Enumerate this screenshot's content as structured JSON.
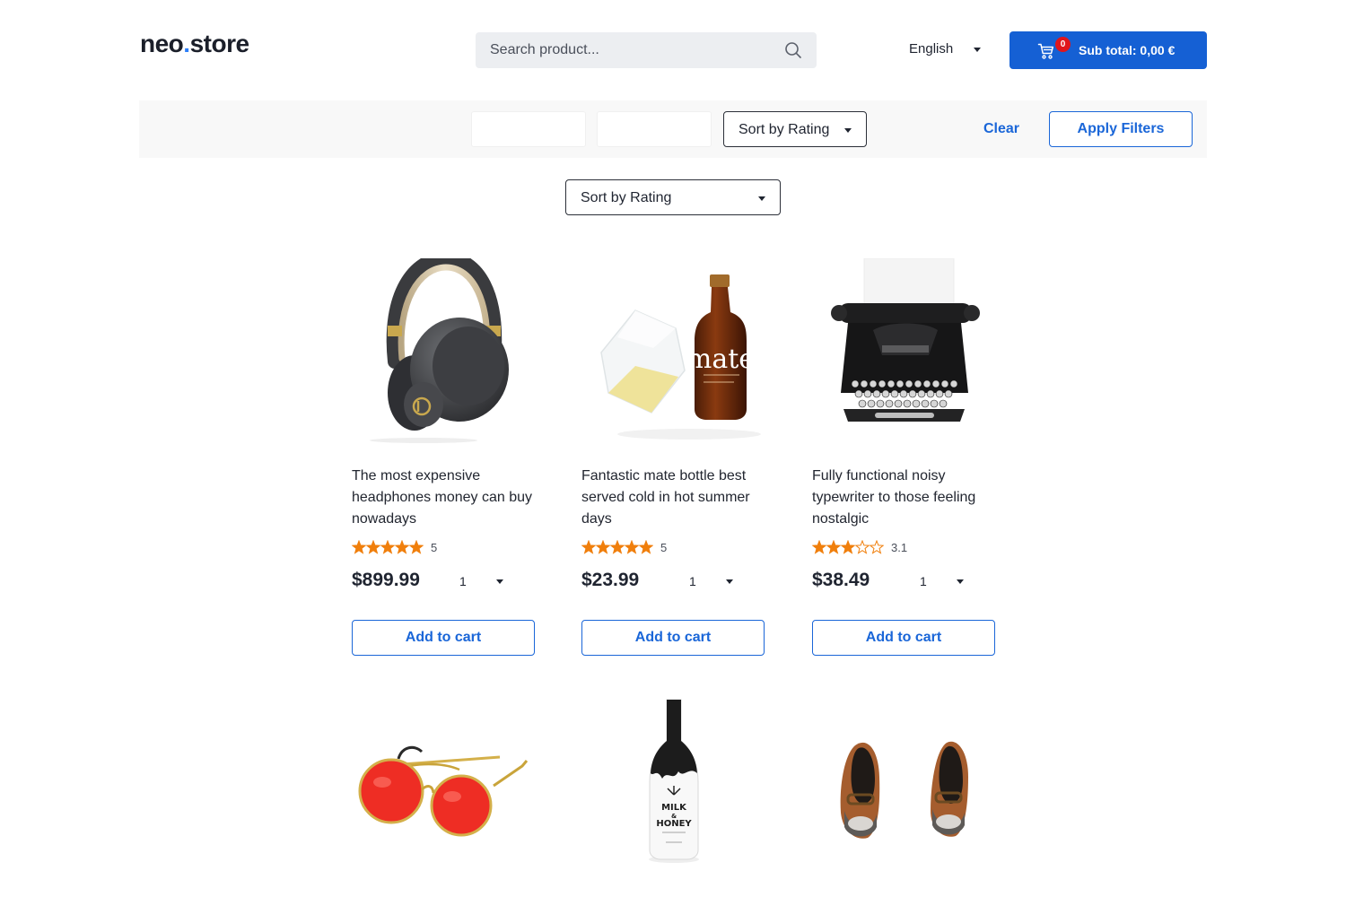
{
  "header": {
    "logo_left": "neo",
    "logo_dot": ".",
    "logo_right": "store",
    "search_placeholder": "Search product...",
    "language": "English",
    "cart_count": "0",
    "subtotal": "Sub total: 0,00 €"
  },
  "filters": {
    "sort_label": "Sort by Rating",
    "clear_label": "Clear",
    "apply_label": "Apply Filters"
  },
  "main": {
    "sort_label": "Sort by Rating"
  },
  "colors": {
    "accent": "#1a66d8",
    "cart_button": "#1560d4",
    "badge": "#e0151b",
    "star": "#f07f0c"
  },
  "products": [
    {
      "description": "The most expensive headphones money can buy nowadays",
      "rating": "5",
      "rating_value": 5,
      "price": "$899.99",
      "quantity": "1",
      "add_label": "Add to cart",
      "image": "headphones"
    },
    {
      "description": "Fantastic mate bottle best served cold in hot summer days",
      "rating": "5",
      "rating_value": 5,
      "price": "$23.99",
      "quantity": "1",
      "add_label": "Add to cart",
      "image": "mate-bottle",
      "image_text": "mate"
    },
    {
      "description": "Fully functional noisy typewriter to those feeling nostalgic",
      "rating": "3.1",
      "rating_value": 3.1,
      "price": "$38.49",
      "quantity": "1",
      "add_label": "Add to cart",
      "image": "typewriter"
    },
    {
      "image": "red-sunglasses"
    },
    {
      "image": "milk-honey-bottle",
      "image_text_1": "MILK",
      "image_text_2": "&",
      "image_text_3": "HONEY"
    },
    {
      "image": "flat-shoes"
    }
  ]
}
